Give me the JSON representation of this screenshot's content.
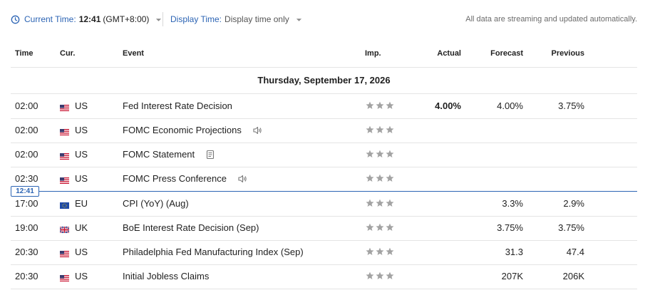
{
  "toolbar": {
    "current_time_label": "Current Time:",
    "current_time_value": "12:41",
    "timezone": "(GMT+8:00)",
    "display_time_label": "Display Time:",
    "display_time_value": "Display time only",
    "streaming_note": "All data are streaming and updated automatically."
  },
  "columns": {
    "time": "Time",
    "currency": "Cur.",
    "event": "Event",
    "importance": "Imp.",
    "actual": "Actual",
    "forecast": "Forecast",
    "previous": "Previous"
  },
  "date_header": "Thursday, September 17, 2026",
  "now_marker": "12:41",
  "rows": [
    {
      "time": "02:00",
      "currency": "US",
      "flag": "us-flag",
      "event": "Fed Interest Rate Decision",
      "icon": "",
      "actual": "4.00%",
      "forecast": "4.00%",
      "previous": "3.75%"
    },
    {
      "time": "02:00",
      "currency": "US",
      "flag": "us-flag",
      "event": "FOMC Economic Projections",
      "icon": "speaker-icon",
      "actual": "",
      "forecast": "",
      "previous": ""
    },
    {
      "time": "02:00",
      "currency": "US",
      "flag": "us-flag",
      "event": "FOMC Statement",
      "icon": "document-icon",
      "actual": "",
      "forecast": "",
      "previous": ""
    },
    {
      "time": "02:30",
      "currency": "US",
      "flag": "us-flag",
      "event": "FOMC Press Conference",
      "icon": "speaker-icon",
      "actual": "",
      "forecast": "",
      "previous": ""
    },
    {
      "time": "17:00",
      "currency": "EU",
      "flag": "eu-flag",
      "event": "CPI (YoY) (Aug)",
      "icon": "",
      "actual": "",
      "forecast": "3.3%",
      "previous": "2.9%"
    },
    {
      "time": "19:00",
      "currency": "UK",
      "flag": "uk-flag",
      "event": "BoE Interest Rate Decision  (Sep)",
      "icon": "",
      "actual": "",
      "forecast": "3.75%",
      "previous": "3.75%"
    },
    {
      "time": "20:30",
      "currency": "US",
      "flag": "us-flag",
      "event": "Philadelphia Fed Manufacturing Index  (Sep)",
      "icon": "",
      "actual": "",
      "forecast": "31.3",
      "previous": "47.4"
    },
    {
      "time": "20:30",
      "currency": "US",
      "flag": "us-flag",
      "event": "Initial Jobless Claims",
      "icon": "",
      "actual": "",
      "forecast": "207K",
      "previous": "206K"
    }
  ],
  "importance_stars": 3,
  "colors": {
    "accent": "#2c64b4",
    "star": "#a3a3a3",
    "divider": "#e4e4e4"
  }
}
